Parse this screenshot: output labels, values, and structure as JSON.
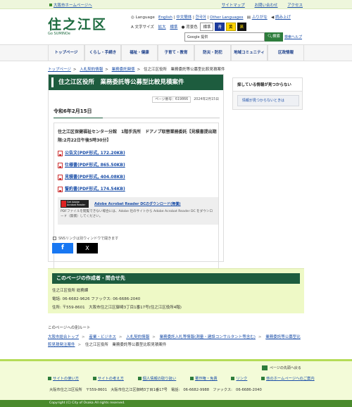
{
  "top": {
    "osaka_link": "大阪市ホームページへ",
    "links": [
      "サイトマップ",
      "お問い合わせ",
      "アクセス"
    ]
  },
  "logo": {
    "main": "住之江区",
    "sub": "Go SUMINOe"
  },
  "util": {
    "language": "Language",
    "lang_links": [
      "English",
      "中文簡体",
      "한국어",
      "Other Languages"
    ],
    "furigana": "ふりがな",
    "read": "読み上げ",
    "text_size": "文字サイズ",
    "enlarge": "拡大",
    "standard": "標準",
    "bgcolor": "背景色",
    "bg_standard": "標準",
    "bg_blue": "青",
    "bg_yellow": "黄",
    "bg_black": "黒"
  },
  "search": {
    "placeholder": "Google 提供",
    "button": "検索",
    "help": "検索ヘルプ"
  },
  "nav": [
    "トップページ",
    "くらし・手続き",
    "福祉・健康",
    "子育て・教育",
    "防災・防犯",
    "地域コミュニティ",
    "区政情報"
  ],
  "breadcrumb": [
    "トップページ",
    "入札契約情報",
    "業務委託関係",
    "住之江区役所　業務委託等公募型比較見積案件"
  ],
  "page": {
    "title": "住之江区役所　業務委託等公募型比較見積案件",
    "page_id": "ページ番号：619866",
    "updated": "2024年2月15日",
    "date": "令和6年2月15日",
    "body": "住之江区保健福祉センター分館　1階手洗所　ドアノブ取替業務委託【見積書提出期限:2月22日午後5時30分】"
  },
  "pdfs": [
    "公告文(PDF形式, 172.20KB)",
    "仕様書(PDF形式, 865.50KB)",
    "見積書(PDF形式, 404.08KB)",
    "誓約書(PDF形式, 174.54KB)"
  ],
  "adobe": {
    "badge": "Get Adobe Acrobat Reader",
    "link": "Adobe Acrobat Reader DCのダウンロード(無償)",
    "text": "PDFファイルを閲覧できない場合には、Adobe 社のサイトから Adobe Acrobat Reader DC をダウンロード（無償）してください。"
  },
  "sns": {
    "note": "SNSリンクは別ウィンドウで開きます",
    "fb": "f",
    "x": "X"
  },
  "side": {
    "heading": "探している情報が見つからない",
    "button": "情報が見つからないときは"
  },
  "contact": {
    "heading": "このページの作成者・問合せ先",
    "name": "住之江区役所 総務課",
    "tel": "電話: 06-6682-9626 ファックス: 06-6686-2040",
    "addr": "住所: 〒559-8601　大阪市住之江区御崎3丁目1番17号(住之江区役所4階)"
  },
  "path": {
    "heading": "このページへの別ルート",
    "items": [
      "大阪市総合トップ",
      "産業・ビジネス",
      "入札契約情報",
      "業務委託入札等情報(測量・建設コンサルタント等含む)",
      "業務委託等公募型比較見積発注案件",
      "住之江区役所　業務委託等公募型比較見積案件"
    ]
  },
  "footer": {
    "pagetop": "ページの先頭へ戻る",
    "links": [
      "サイトの使い方",
      "サイトの考え方",
      "個人情報の取り扱い",
      "著作権・免責",
      "リンク",
      "他のホームページへのご案内"
    ],
    "address": "大阪市住之江区役所　〒559-8601　大阪市住之江区御崎3丁目1番17号　電話:　06-6682-9988　ファックス:　06-6686-2040",
    "copyright": "Copyright (C) City of Osaka All rights reserved."
  }
}
